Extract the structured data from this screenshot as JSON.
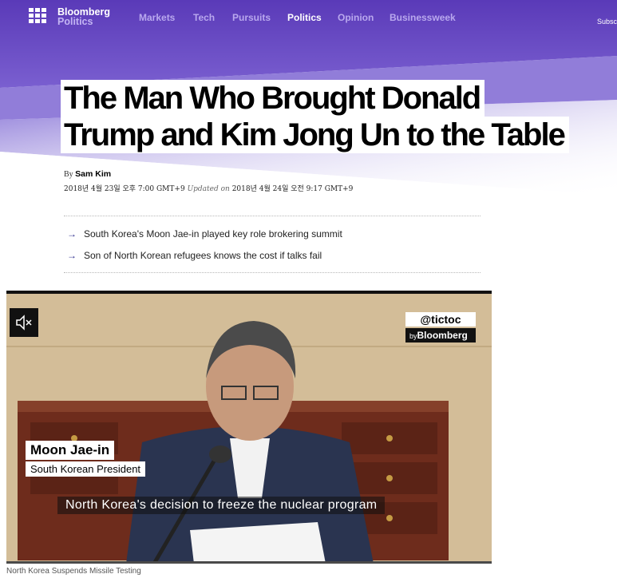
{
  "nav": {
    "logo_top": "Bloomberg",
    "logo_bottom": "Politics",
    "items": [
      {
        "label": "Markets"
      },
      {
        "label": "Tech"
      },
      {
        "label": "Pursuits"
      },
      {
        "label": "Politics",
        "active": true
      },
      {
        "label": "Opinion"
      },
      {
        "label": "Businessweek"
      }
    ],
    "subscribe": "Subscr"
  },
  "article": {
    "headline_line1": "The Man Who Brought Donald",
    "headline_line2": "Trump and Kim Jong Un to the Table",
    "by_prefix": "By",
    "author": "Sam Kim",
    "published": "2018년 4월 23일 오후 7:00 GMT+9",
    "updated_label": "Updated on",
    "updated": "2018년 4월 24일 오전 9:17 GMT+9",
    "summary": [
      {
        "arrow": "→",
        "text": "South Korea's Moon Jae-in played key role brokering summit"
      },
      {
        "arrow": "→",
        "text": "Son of North Korean refugees knows the cost if talks fail"
      }
    ]
  },
  "video": {
    "brand_handle": "@tictoc",
    "brand_by": "by",
    "brand_name": "Bloomberg",
    "speaker_name": "Moon Jae-in",
    "speaker_title": "South Korean President",
    "subtitle": "North Korea's decision to freeze the nuclear program",
    "title": "North Korea Suspends Missile Testing",
    "muted": true
  },
  "colors": {
    "brand_purple": "#5b3fbf",
    "nav_inactive": "#b9a8ee",
    "arrow": "#2b2b8c"
  }
}
